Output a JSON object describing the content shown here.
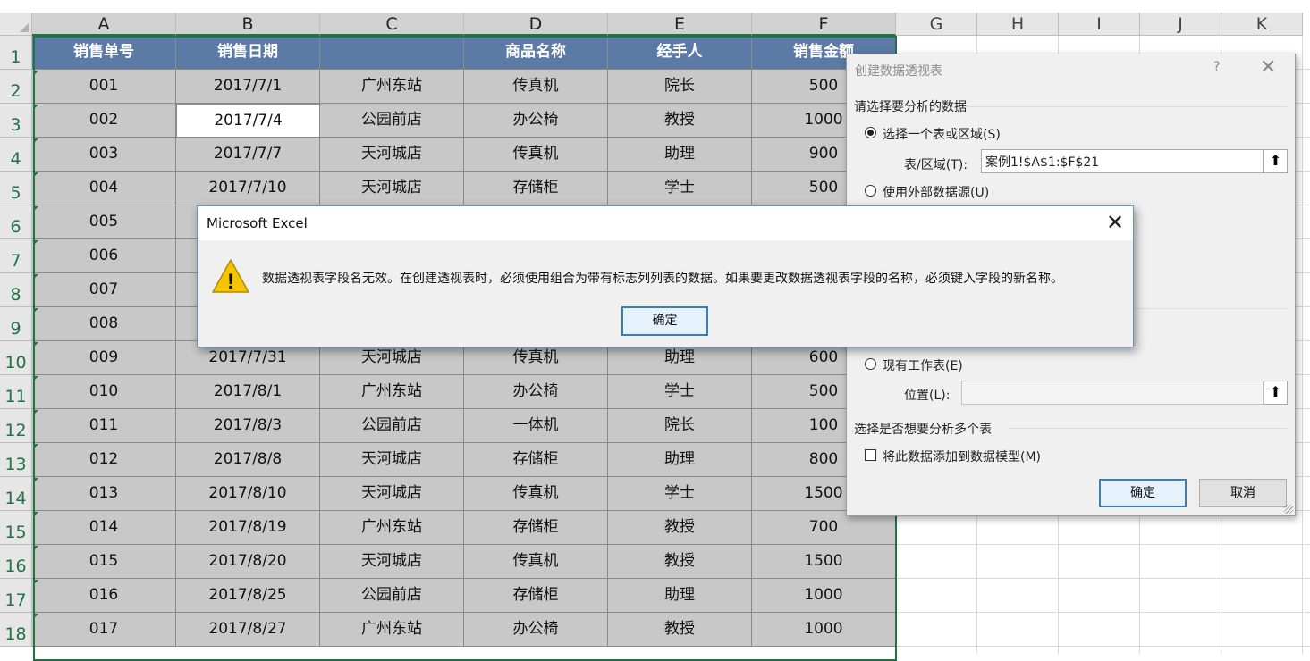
{
  "sheet": {
    "columns": [
      "A",
      "B",
      "C",
      "D",
      "E",
      "F",
      "G",
      "H",
      "I",
      "J",
      "K"
    ],
    "rows": [
      "1",
      "2",
      "3",
      "4",
      "5",
      "6",
      "7",
      "8",
      "9",
      "10",
      "11",
      "12",
      "13",
      "14",
      "15",
      "16",
      "17",
      "18"
    ],
    "header": [
      "销售单号",
      "销售日期",
      "",
      "商品名称",
      "经手人",
      "销售金额"
    ],
    "data": [
      [
        "001",
        "2017/7/1",
        "广州东站",
        "传真机",
        "院长",
        "500"
      ],
      [
        "002",
        "2017/7/4",
        "公园前店",
        "办公椅",
        "教授",
        "1000"
      ],
      [
        "003",
        "2017/7/7",
        "天河城店",
        "传真机",
        "助理",
        "900"
      ],
      [
        "004",
        "2017/7/10",
        "天河城店",
        "存储柜",
        "学士",
        "500"
      ],
      [
        "005",
        "",
        "",
        "",
        "",
        ""
      ],
      [
        "006",
        "",
        "",
        "",
        "",
        ""
      ],
      [
        "007",
        "",
        "",
        "",
        "",
        ""
      ],
      [
        "008",
        "",
        "",
        "",
        "",
        ""
      ],
      [
        "009",
        "2017/7/31",
        "天河城店",
        "传真机",
        "助理",
        "600"
      ],
      [
        "010",
        "2017/8/1",
        "广州东站",
        "办公椅",
        "学士",
        "500"
      ],
      [
        "011",
        "2017/8/3",
        "公园前店",
        "一体机",
        "院长",
        "100"
      ],
      [
        "012",
        "2017/8/8",
        "天河城店",
        "存储柜",
        "助理",
        "800"
      ],
      [
        "013",
        "2017/8/10",
        "天河城店",
        "传真机",
        "学士",
        "1500"
      ],
      [
        "014",
        "2017/8/19",
        "广州东站",
        "存储柜",
        "教授",
        "700"
      ],
      [
        "015",
        "2017/8/20",
        "天河城店",
        "传真机",
        "教授",
        "1500"
      ],
      [
        "016",
        "2017/8/25",
        "公园前店",
        "存储柜",
        "助理",
        "1000"
      ],
      [
        "017",
        "2017/8/27",
        "广州东站",
        "办公椅",
        "教授",
        "1000"
      ]
    ]
  },
  "pivot_dialog": {
    "title": "创建数据透视表",
    "help": "?",
    "close": "✕",
    "section_data": "请选择要分析的数据",
    "opt_table": "选择一个表或区域(S)",
    "range_label": "表/区域(T):",
    "range_value": "案例1!$A$1:$F$21",
    "opt_external": "使用外部数据源(U)",
    "opt_existing": "现有工作表(E)",
    "location_label": "位置(L):",
    "location_value": "",
    "section_multi": "选择是否想要分析多个表",
    "add_model": "将此数据添加到数据模型(M)",
    "ok": "确定",
    "cancel": "取消"
  },
  "message_box": {
    "title": "Microsoft Excel",
    "close": "✕",
    "text": "数据透视表字段名无效。在创建透视表时，必须使用组合为带有标志列列表的数据。如果要更改数据透视表字段的名称，必须键入字段的新名称。",
    "ok": "确定",
    "warn_glyph": "!"
  },
  "colors": {
    "header_fill": "#5b7aa6",
    "cell_fill": "#c8c8c8",
    "accent": "#217346",
    "warning": "#f5c400"
  }
}
